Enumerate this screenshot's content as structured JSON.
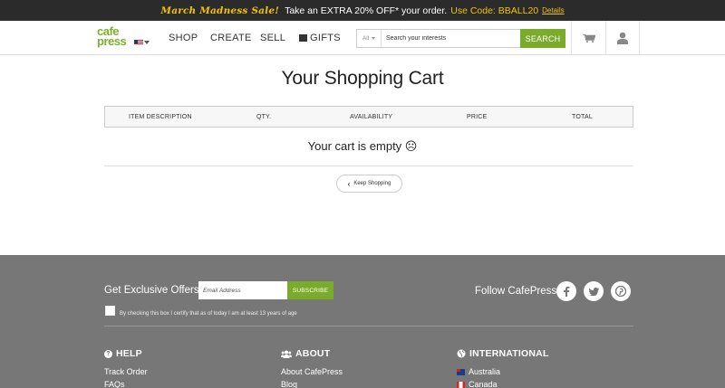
{
  "promo": {
    "sale": "March Madness Sale!",
    "text": "Take an EXTRA 20% OFF* your order.",
    "code": "Use Code: BBALL20",
    "details": "Details"
  },
  "header": {
    "logo_top": "cafe",
    "logo_bottom": "press",
    "nav": [
      "SHOP",
      "CREATE",
      "SELL",
      "GIFTS"
    ],
    "search": {
      "category": "All",
      "placeholder": "Search your interests",
      "button": "SEARCH"
    }
  },
  "cart": {
    "title": "Your Shopping Cart",
    "columns": [
      "ITEM DESCRIPTION",
      "QTY.",
      "AVAILABILITY",
      "PRICE",
      "TOTAL"
    ],
    "empty_message": "Your cart is empty ☹",
    "keep_shopping": "Keep Shopping"
  },
  "footer": {
    "offers_label": "Get Exclusive Offers:",
    "email_placeholder": "Email Address",
    "subscribe": "SUBSCRIBE",
    "certify": "By checking this box I certify that as of today I am at least 13 years of age",
    "follow": "Follow CafePress:",
    "social": [
      "facebook-icon",
      "twitter-icon",
      "pinterest-icon"
    ],
    "columns": [
      {
        "title": "HELP",
        "icon": "question-icon",
        "links": [
          "Track Order",
          "FAQs"
        ]
      },
      {
        "title": "ABOUT",
        "icon": "users-icon",
        "links": [
          "About CafePress",
          "Blog"
        ]
      },
      {
        "title": "INTERNATIONAL",
        "icon": "globe-icon",
        "links": [
          "Australia",
          "Canada"
        ]
      }
    ]
  },
  "colors": {
    "accent_green": "#7aab2a",
    "promo_yellow": "#f2c300",
    "footer_bg": "#777777"
  }
}
